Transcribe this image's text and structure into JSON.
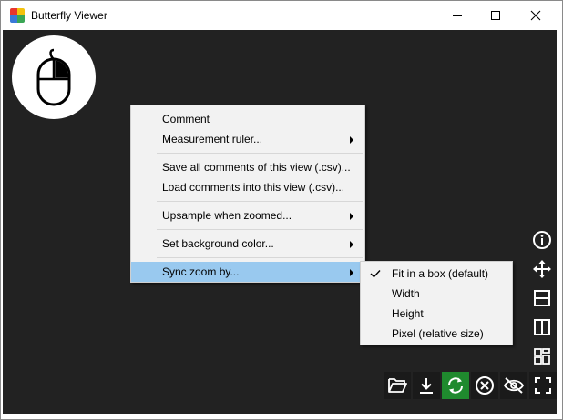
{
  "window": {
    "title": "Butterfly Viewer",
    "icon": "butterfly-viewer-app-icon",
    "controls": [
      "minimize-icon",
      "maximize-icon",
      "close-icon"
    ]
  },
  "canvas": {
    "background": "#222222",
    "mouse_badge_icon": "mouse-icon"
  },
  "context_menu": {
    "items": [
      {
        "label": "Comment",
        "submenu": false
      },
      {
        "label": "Measurement ruler...",
        "submenu": true
      },
      {
        "label": "Save all comments of this view (.csv)...",
        "submenu": false
      },
      {
        "label": "Load comments into this view (.csv)...",
        "submenu": false
      },
      {
        "label": "Upsample when zoomed...",
        "submenu": true
      },
      {
        "label": "Set background color...",
        "submenu": true
      },
      {
        "label": "Sync zoom by...",
        "submenu": true,
        "highlighted": true
      }
    ]
  },
  "sync_zoom_submenu": {
    "items": [
      {
        "label": "Fit in a box (default)",
        "checked": true
      },
      {
        "label": "Width",
        "checked": false
      },
      {
        "label": "Height",
        "checked": false
      },
      {
        "label": "Pixel (relative size)",
        "checked": false
      }
    ]
  },
  "side_toolbar": [
    "info-icon",
    "move-arrows-icon",
    "split-horizontal-icon",
    "split-vertical-icon",
    "grid-layout-icon"
  ],
  "bottom_toolbar": [
    "open-folder-icon",
    "download-icon",
    "sync-icon",
    "close-circle-icon",
    "hide-eye-icon",
    "fullscreen-icon"
  ],
  "colors": {
    "menu_highlight": "#99c9ef",
    "sync_active": "#1f8a2e",
    "canvas": "#222222"
  }
}
